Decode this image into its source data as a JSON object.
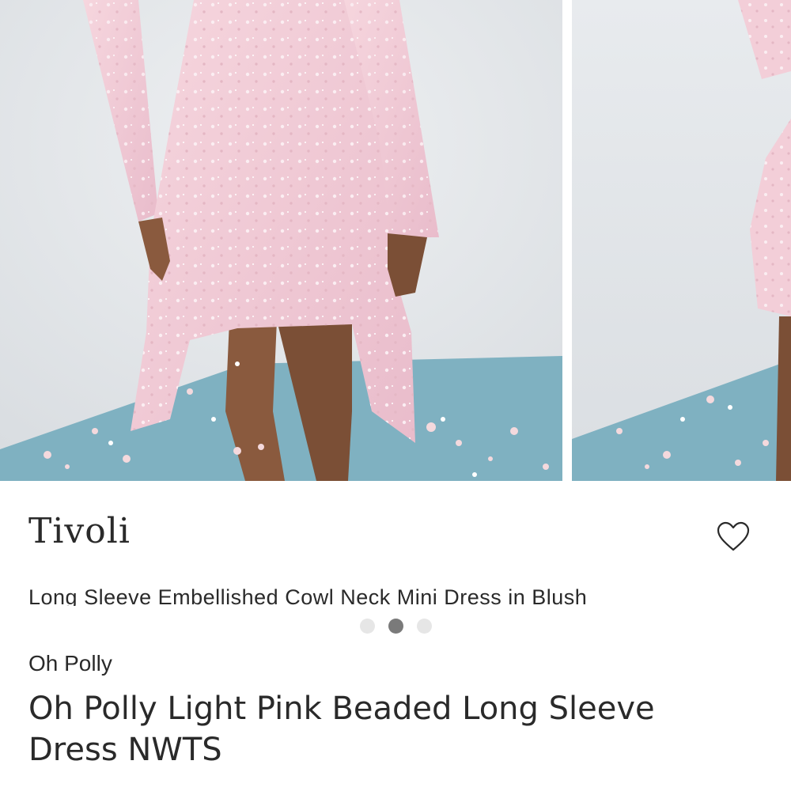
{
  "gallery": {
    "main_photo_alt": "",
    "colors": {
      "wall": "#e6e9ec",
      "floor": "#7fb2c2",
      "dress": "#f1c9d3"
    }
  },
  "product": {
    "inner_title": "Tivoli",
    "inner_subtitle": "Long Sleeve Embellished Cowl Neck Mini Dress in Blush",
    "brand": "Oh Polly",
    "title": "Oh Polly Light Pink Beaded Long Sleeve Dress NWTS"
  },
  "carousel": {
    "total": 3,
    "active_index": 1
  },
  "icons": {
    "like": "heart-outline-icon"
  }
}
